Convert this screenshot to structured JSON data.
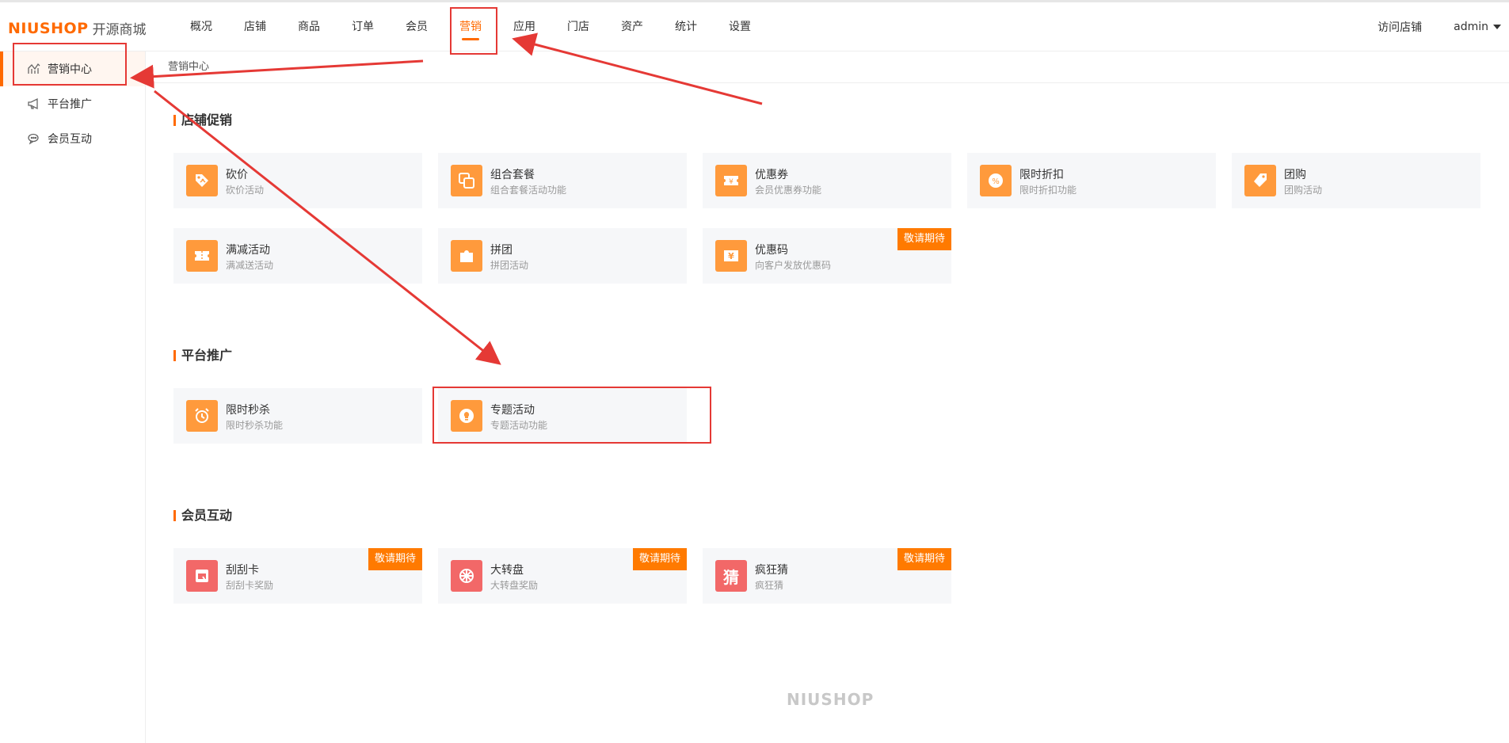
{
  "header": {
    "brand": "NIUSHOP",
    "brand_sub": "开源商城",
    "nav": [
      "概况",
      "店铺",
      "商品",
      "订单",
      "会员",
      "营销",
      "应用",
      "门店",
      "资产",
      "统计",
      "设置"
    ],
    "active_nav": "营销",
    "visit_store": "访问店铺",
    "user": "admin"
  },
  "sidebar": {
    "items": [
      {
        "label": "营销中心",
        "icon": "chart-icon",
        "active": true
      },
      {
        "label": "平台推广",
        "icon": "megaphone-icon",
        "active": false
      },
      {
        "label": "会员互动",
        "icon": "chat-icon",
        "active": false
      }
    ]
  },
  "breadcrumb": "营销中心",
  "sections": [
    {
      "title": "店铺促销",
      "cards": [
        {
          "title": "砍价",
          "desc": "砍价活动",
          "icon": "price-tag-cut-icon",
          "badge": ""
        },
        {
          "title": "组合套餐",
          "desc": "组合套餐活动功能",
          "icon": "bundle-icon",
          "badge": ""
        },
        {
          "title": "优惠券",
          "desc": "会员优惠券功能",
          "icon": "coupon-icon",
          "badge": ""
        },
        {
          "title": "限时折扣",
          "desc": "限时折扣功能",
          "icon": "percent-badge-icon",
          "badge": ""
        },
        {
          "title": "团购",
          "desc": "团购活动",
          "icon": "tag-icon",
          "badge": ""
        },
        {
          "title": "满减活动",
          "desc": "满减送活动",
          "icon": "ticket-icon",
          "badge": ""
        },
        {
          "title": "拼团",
          "desc": "拼团活动",
          "icon": "puzzle-icon",
          "badge": ""
        },
        {
          "title": "优惠码",
          "desc": "向客户发放优惠码",
          "icon": "yen-ticket-icon",
          "badge": "敬请期待"
        }
      ]
    },
    {
      "title": "平台推广",
      "cards": [
        {
          "title": "限时秒杀",
          "desc": "限时秒杀功能",
          "icon": "alarm-clock-icon",
          "badge": ""
        },
        {
          "title": "专题活动",
          "desc": "专题活动功能",
          "icon": "lightbulb-icon",
          "badge": ""
        }
      ]
    },
    {
      "title": "会员互动",
      "cards": [
        {
          "title": "刮刮卡",
          "desc": "刮刮卡奖励",
          "icon": "scratch-card-icon",
          "badge": "敬请期待"
        },
        {
          "title": "大转盘",
          "desc": "大转盘奖励",
          "icon": "wheel-icon",
          "badge": "敬请期待"
        },
        {
          "title": "疯狂猜",
          "desc": "疯狂猜",
          "icon": "guess-icon",
          "badge": "敬请期待",
          "icon_text": "猜"
        }
      ]
    }
  ],
  "footer_brand": "NIUSHOP",
  "colors": {
    "accent": "#ff6a00",
    "icon_orange": "#ff9a3c",
    "icon_red": "#f26868",
    "badge": "#ff7a00",
    "annotation": "#e53935"
  }
}
